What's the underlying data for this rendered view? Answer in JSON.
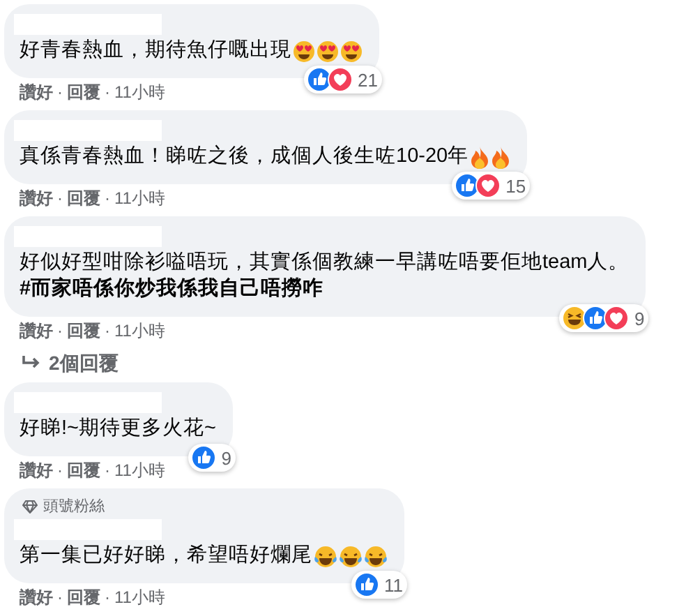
{
  "comments": [
    {
      "lines": [
        "好青春熱血，期待魚仔嘅出現"
      ],
      "emoji": [
        {
          "kind": "heart-eyes"
        },
        {
          "kind": "heart-eyes"
        },
        {
          "kind": "heart-eyes"
        }
      ],
      "reactions": [
        {
          "kind": "like"
        },
        {
          "kind": "love"
        }
      ],
      "reaction_count": "21",
      "actions": [
        {
          "kind": "like",
          "text": "讚好"
        },
        {
          "kind": "separator",
          "text": "·"
        },
        {
          "kind": "reply",
          "text": "回覆"
        },
        {
          "kind": "separator",
          "text": "·"
        },
        {
          "kind": "time",
          "text": "11小時"
        }
      ]
    },
    {
      "lines": [
        "真係青春熱血！睇咗之後，成個人後生咗10-20年"
      ],
      "emoji": [
        {
          "kind": "fire"
        },
        {
          "kind": "fire"
        }
      ],
      "reactions": [
        {
          "kind": "like"
        },
        {
          "kind": "love"
        }
      ],
      "reaction_count": "15",
      "actions": [
        {
          "kind": "like",
          "text": "讚好"
        },
        {
          "kind": "separator",
          "text": "·"
        },
        {
          "kind": "reply",
          "text": "回覆"
        },
        {
          "kind": "separator",
          "text": "·"
        },
        {
          "kind": "time",
          "text": "11小時"
        }
      ]
    },
    {
      "lines": [
        "好似好型咁除衫嗌唔玩，其實係個教練一早講咗唔要佢地team人。",
        "**#而家唔係你炒我係我自己唔撈咋**"
      ],
      "reactions": [
        {
          "kind": "haha"
        },
        {
          "kind": "like"
        },
        {
          "kind": "love"
        }
      ],
      "reaction_count": "9",
      "actions": [
        {
          "kind": "like",
          "text": "讚好"
        },
        {
          "kind": "separator",
          "text": "·"
        },
        {
          "kind": "reply",
          "text": "回覆"
        },
        {
          "kind": "separator",
          "text": "·"
        },
        {
          "kind": "time",
          "text": "11小時"
        }
      ],
      "replies_link": "2個回覆"
    },
    {
      "lines": [
        "好睇!~期待更多火花~"
      ],
      "reactions": [
        {
          "kind": "like"
        }
      ],
      "reaction_count": "9",
      "actions": [
        {
          "kind": "like",
          "text": "讚好"
        },
        {
          "kind": "separator",
          "text": "·"
        },
        {
          "kind": "reply",
          "text": "回覆"
        },
        {
          "kind": "separator",
          "text": "·"
        },
        {
          "kind": "time",
          "text": "11小時"
        }
      ]
    },
    {
      "badge": "頭號粉絲",
      "lines": [
        "第一集已好好睇，希望唔好爛尾"
      ],
      "emoji": [
        {
          "kind": "laugh-tears"
        },
        {
          "kind": "laugh-tears"
        },
        {
          "kind": "laugh-tears"
        }
      ],
      "reactions": [
        {
          "kind": "like"
        }
      ],
      "reaction_count": "11",
      "actions": [
        {
          "kind": "like",
          "text": "讚好"
        },
        {
          "kind": "separator",
          "text": "·"
        },
        {
          "kind": "reply",
          "text": "回覆"
        },
        {
          "kind": "separator",
          "text": "·"
        },
        {
          "kind": "time",
          "text": "11小時"
        }
      ]
    }
  ]
}
